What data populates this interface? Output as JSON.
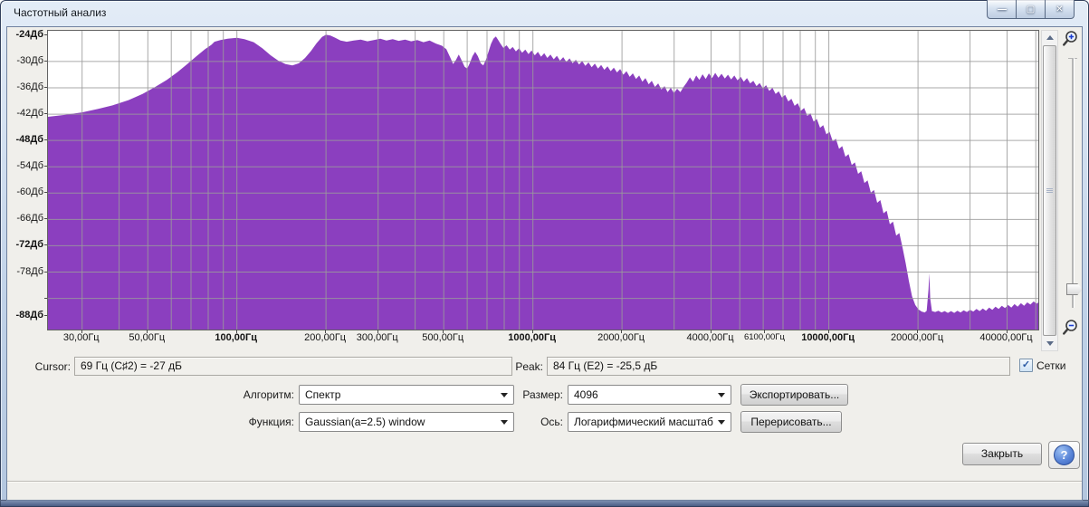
{
  "window": {
    "title": "Частотный анализ",
    "caption_buttons": [
      {
        "name": "minimize",
        "glyph": "—"
      },
      {
        "name": "maximize",
        "glyph": "▢"
      },
      {
        "name": "close",
        "glyph": "✕"
      }
    ]
  },
  "chart_data": {
    "type": "area",
    "series_name": "spectrum",
    "fill_color": "#8b3fbf",
    "grid_color": "#9b9b9b",
    "background": "#ffffff",
    "legend": "none",
    "x_axis": {
      "scale": "log",
      "unit": "Гц",
      "min_hz": 23,
      "max_hz": 51000,
      "tick_labels": [
        {
          "hz": 30,
          "label": "30,00Гц"
        },
        {
          "hz": 50,
          "label": "50,00Гц"
        },
        {
          "hz": 100,
          "label": "100,00Гц",
          "bold": true
        },
        {
          "hz": 200,
          "label": "200,00Гц"
        },
        {
          "hz": 300,
          "label": "300,00Гц"
        },
        {
          "hz": 500,
          "label": "500,00Гц"
        },
        {
          "hz": 1000,
          "label": "1000,00Гц",
          "bold": true
        },
        {
          "hz": 2000,
          "label": "2000,00Гц"
        },
        {
          "hz": 4000,
          "label": "4000,00Гц"
        },
        {
          "hz": 6100,
          "label": "6100,00Гц",
          "small": true
        },
        {
          "hz": 10000,
          "label": "10000,00Гц",
          "bold": true
        },
        {
          "hz": 20000,
          "label": "20000,00Гц"
        },
        {
          "hz": 40000,
          "label": "40000,00Гц"
        }
      ],
      "grid_hz": [
        30,
        40,
        50,
        60,
        70,
        80,
        90,
        100,
        200,
        300,
        400,
        500,
        600,
        700,
        800,
        900,
        1000,
        2000,
        3000,
        4000,
        5000,
        6000,
        7000,
        8000,
        9000,
        10000,
        20000,
        30000,
        40000,
        50000
      ]
    },
    "y_axis": {
      "unit": "Дб",
      "top_db": -23,
      "bottom_db": -91.1,
      "tick_labels": [
        {
          "db": -24,
          "label": "-24Дб",
          "bold": true
        },
        {
          "db": -30,
          "label": "-30Дб"
        },
        {
          "db": -36,
          "label": "-36Дб"
        },
        {
          "db": -42,
          "label": "-42Дб"
        },
        {
          "db": -48,
          "label": "-48Дб",
          "bold": true
        },
        {
          "db": -54,
          "label": "-54Дб"
        },
        {
          "db": -60,
          "label": "-60Дб"
        },
        {
          "db": -66,
          "label": "-66Дб"
        },
        {
          "db": -72,
          "label": "-72Дб",
          "bold": true
        },
        {
          "db": -78,
          "label": "-78Дб"
        },
        {
          "db": -88,
          "label": "-88Дб",
          "bold": true
        }
      ],
      "grid_db": [
        -30,
        -36,
        -42,
        -48,
        -54,
        -60,
        -66,
        -72,
        -78,
        -84
      ]
    },
    "points": [
      [
        23,
        -42.6
      ],
      [
        26,
        -42.2
      ],
      [
        30,
        -41.6
      ],
      [
        34,
        -40.8
      ],
      [
        38,
        -40.0
      ],
      [
        43,
        -38.8
      ],
      [
        48,
        -37.4
      ],
      [
        53,
        -35.8
      ],
      [
        58,
        -34.2
      ],
      [
        63,
        -32.4
      ],
      [
        68,
        -30.6
      ],
      [
        73,
        -28.8
      ],
      [
        78,
        -27.2
      ],
      [
        82,
        -26.2
      ],
      [
        84,
        -25.5
      ],
      [
        88,
        -25.1
      ],
      [
        93,
        -24.8
      ],
      [
        100,
        -24.6
      ],
      [
        106,
        -24.9
      ],
      [
        114,
        -25.6
      ],
      [
        122,
        -27.0
      ],
      [
        130,
        -28.6
      ],
      [
        138,
        -29.8
      ],
      [
        146,
        -30.6
      ],
      [
        154,
        -30.9
      ],
      [
        162,
        -30.4
      ],
      [
        170,
        -29.2
      ],
      [
        178,
        -27.6
      ],
      [
        186,
        -25.8
      ],
      [
        194,
        -24.4
      ],
      [
        200,
        -23.9
      ],
      [
        207,
        -24.1
      ],
      [
        215,
        -24.6
      ],
      [
        224,
        -25.2
      ],
      [
        235,
        -25.5
      ],
      [
        248,
        -25.2
      ],
      [
        262,
        -25.0
      ],
      [
        276,
        -25.4
      ],
      [
        290,
        -25.1
      ],
      [
        305,
        -24.8
      ],
      [
        320,
        -25.2
      ],
      [
        336,
        -24.9
      ],
      [
        352,
        -25.3
      ],
      [
        370,
        -25.0
      ],
      [
        388,
        -25.4
      ],
      [
        407,
        -25.1
      ],
      [
        427,
        -25.6
      ],
      [
        448,
        -25.2
      ],
      [
        470,
        -25.9
      ],
      [
        493,
        -26.4
      ],
      [
        510,
        -27.2
      ],
      [
        525,
        -29.0
      ],
      [
        538,
        -30.6
      ],
      [
        550,
        -29.6
      ],
      [
        562,
        -28.4
      ],
      [
        575,
        -29.8
      ],
      [
        588,
        -31.2
      ],
      [
        600,
        -31.6
      ],
      [
        612,
        -30.4
      ],
      [
        625,
        -28.8
      ],
      [
        638,
        -27.8
      ],
      [
        652,
        -28.8
      ],
      [
        666,
        -30.4
      ],
      [
        680,
        -30.9
      ],
      [
        694,
        -29.6
      ],
      [
        708,
        -27.8
      ],
      [
        722,
        -26.0
      ],
      [
        736,
        -24.8
      ],
      [
        750,
        -24.3
      ],
      [
        764,
        -25.1
      ],
      [
        778,
        -26.0
      ],
      [
        795,
        -26.9
      ],
      [
        815,
        -26.3
      ],
      [
        835,
        -27.3
      ],
      [
        855,
        -26.7
      ],
      [
        876,
        -27.7
      ],
      [
        898,
        -27.0
      ],
      [
        920,
        -28.0
      ],
      [
        943,
        -27.3
      ],
      [
        966,
        -28.3
      ],
      [
        990,
        -27.5
      ],
      [
        1015,
        -28.6
      ],
      [
        1040,
        -27.8
      ],
      [
        1066,
        -28.9
      ],
      [
        1092,
        -28.1
      ],
      [
        1119,
        -29.2
      ],
      [
        1147,
        -28.4
      ],
      [
        1176,
        -29.5
      ],
      [
        1205,
        -28.7
      ],
      [
        1235,
        -29.8
      ],
      [
        1266,
        -29.0
      ],
      [
        1297,
        -30.1
      ],
      [
        1330,
        -29.3
      ],
      [
        1363,
        -30.4
      ],
      [
        1397,
        -29.6
      ],
      [
        1432,
        -30.7
      ],
      [
        1467,
        -29.9
      ],
      [
        1504,
        -31.0
      ],
      [
        1541,
        -30.2
      ],
      [
        1580,
        -31.3
      ],
      [
        1619,
        -30.5
      ],
      [
        1659,
        -31.6
      ],
      [
        1701,
        -30.8
      ],
      [
        1743,
        -31.9
      ],
      [
        1787,
        -31.1
      ],
      [
        1831,
        -32.2
      ],
      [
        1877,
        -31.4
      ],
      [
        1924,
        -32.5
      ],
      [
        1972,
        -31.7
      ],
      [
        2021,
        -33.0
      ],
      [
        2071,
        -32.2
      ],
      [
        2123,
        -33.5
      ],
      [
        2176,
        -32.7
      ],
      [
        2230,
        -34.0
      ],
      [
        2286,
        -33.2
      ],
      [
        2343,
        -34.6
      ],
      [
        2401,
        -33.8
      ],
      [
        2461,
        -35.2
      ],
      [
        2522,
        -34.4
      ],
      [
        2585,
        -35.8
      ],
      [
        2650,
        -35.0
      ],
      [
        2716,
        -36.4
      ],
      [
        2784,
        -35.6
      ],
      [
        2853,
        -37.0
      ],
      [
        2924,
        -36.0
      ],
      [
        2997,
        -37.2
      ],
      [
        3072,
        -36.2
      ],
      [
        3149,
        -37.0
      ],
      [
        3228,
        -35.8
      ],
      [
        3308,
        -34.8
      ],
      [
        3391,
        -33.6
      ],
      [
        3476,
        -34.6
      ],
      [
        3563,
        -33.2
      ],
      [
        3652,
        -34.2
      ],
      [
        3743,
        -32.9
      ],
      [
        3837,
        -34.0
      ],
      [
        3933,
        -32.7
      ],
      [
        4031,
        -33.8
      ],
      [
        4132,
        -32.6
      ],
      [
        4235,
        -33.7
      ],
      [
        4341,
        -32.8
      ],
      [
        4450,
        -33.9
      ],
      [
        4561,
        -33.0
      ],
      [
        4675,
        -34.1
      ],
      [
        4792,
        -33.2
      ],
      [
        4912,
        -34.3
      ],
      [
        5035,
        -33.5
      ],
      [
        5161,
        -34.6
      ],
      [
        5290,
        -33.8
      ],
      [
        5422,
        -35.0
      ],
      [
        5558,
        -34.4
      ],
      [
        5697,
        -35.6
      ],
      [
        5839,
        -34.9
      ],
      [
        5985,
        -36.1
      ],
      [
        6135,
        -35.4
      ],
      [
        6288,
        -36.7
      ],
      [
        6445,
        -36.0
      ],
      [
        6606,
        -37.4
      ],
      [
        6771,
        -36.8
      ],
      [
        6940,
        -38.2
      ],
      [
        7114,
        -37.6
      ],
      [
        7292,
        -39.1
      ],
      [
        7474,
        -38.5
      ],
      [
        7661,
        -40.1
      ],
      [
        7853,
        -39.5
      ],
      [
        8049,
        -41.2
      ],
      [
        8250,
        -40.6
      ],
      [
        8456,
        -42.4
      ],
      [
        8667,
        -41.8
      ],
      [
        8884,
        -43.7
      ],
      [
        9106,
        -43.1
      ],
      [
        9334,
        -45.1
      ],
      [
        9567,
        -44.5
      ],
      [
        9806,
        -46.6
      ],
      [
        10051,
        -46.0
      ],
      [
        10302,
        -48.2
      ],
      [
        10560,
        -47.6
      ],
      [
        10824,
        -49.9
      ],
      [
        11095,
        -49.3
      ],
      [
        11372,
        -51.7
      ],
      [
        11656,
        -51.1
      ],
      [
        11947,
        -53.6
      ],
      [
        12246,
        -53.0
      ],
      [
        12552,
        -55.6
      ],
      [
        12866,
        -55.0
      ],
      [
        13188,
        -57.7
      ],
      [
        13518,
        -57.1
      ],
      [
        13856,
        -59.9
      ],
      [
        14202,
        -59.3
      ],
      [
        14557,
        -62.2
      ],
      [
        14921,
        -61.6
      ],
      [
        15294,
        -64.6
      ],
      [
        15676,
        -64.0
      ],
      [
        16068,
        -67.1
      ],
      [
        16470,
        -66.5
      ],
      [
        16882,
        -69.7
      ],
      [
        17304,
        -69.1
      ],
      [
        17737,
        -72.4
      ],
      [
        18180,
        -76.0
      ],
      [
        18635,
        -80.0
      ],
      [
        19101,
        -83.5
      ],
      [
        19579,
        -85.5
      ],
      [
        20068,
        -86.5
      ],
      [
        20570,
        -87.0
      ],
      [
        21084,
        -87.2
      ],
      [
        21400,
        -86.8
      ],
      [
        21700,
        -82.0
      ],
      [
        21850,
        -78.3
      ],
      [
        22000,
        -84.0
      ],
      [
        22300,
        -86.9
      ],
      [
        22861,
        -87.1
      ],
      [
        23433,
        -86.8
      ],
      [
        24019,
        -87.2
      ],
      [
        24619,
        -86.9
      ],
      [
        25235,
        -87.3
      ],
      [
        25866,
        -86.9
      ],
      [
        26513,
        -87.3
      ],
      [
        27175,
        -86.8
      ],
      [
        27854,
        -87.2
      ],
      [
        28550,
        -86.7
      ],
      [
        29264,
        -87.1
      ],
      [
        30000,
        -86.6
      ],
      [
        30750,
        -87.0
      ],
      [
        31519,
        -86.4
      ],
      [
        32307,
        -86.9
      ],
      [
        33115,
        -86.3
      ],
      [
        33943,
        -86.8
      ],
      [
        34791,
        -86.1
      ],
      [
        35661,
        -86.6
      ],
      [
        36552,
        -85.9
      ],
      [
        37466,
        -86.4
      ],
      [
        38403,
        -85.7
      ],
      [
        39363,
        -86.2
      ],
      [
        40347,
        -85.5
      ],
      [
        41356,
        -86.1
      ],
      [
        42390,
        -85.3
      ],
      [
        43450,
        -85.9
      ],
      [
        44536,
        -85.1
      ],
      [
        45649,
        -85.7
      ],
      [
        46790,
        -84.9
      ],
      [
        47960,
        -85.4
      ],
      [
        49159,
        -84.7
      ],
      [
        50388,
        -85.2
      ],
      [
        51000,
        -84.9
      ]
    ]
  },
  "status": {
    "cursor_label": "Cursor:",
    "cursor_value": "69 Гц (C♯2) = -27 дБ",
    "peak_label": "Peak:",
    "peak_value": "84 Гц (E2) = -25,5 дБ",
    "grids_label": "Сетки",
    "grids_checked": true,
    "check_glyph": "✓"
  },
  "controls": {
    "algorithm_label": "Алгоритм:",
    "algorithm_value": "Спектр",
    "size_label": "Размер:",
    "size_value": "4096",
    "export_button": "Экспортировать...",
    "function_label": "Функция:",
    "function_value": "Gaussian(a=2.5) window",
    "axis_label": "Ось:",
    "axis_value": "Логарифмический масштаб",
    "replot_button": "Перерисовать...",
    "close_button": "Закрыть",
    "help_button": "?"
  }
}
